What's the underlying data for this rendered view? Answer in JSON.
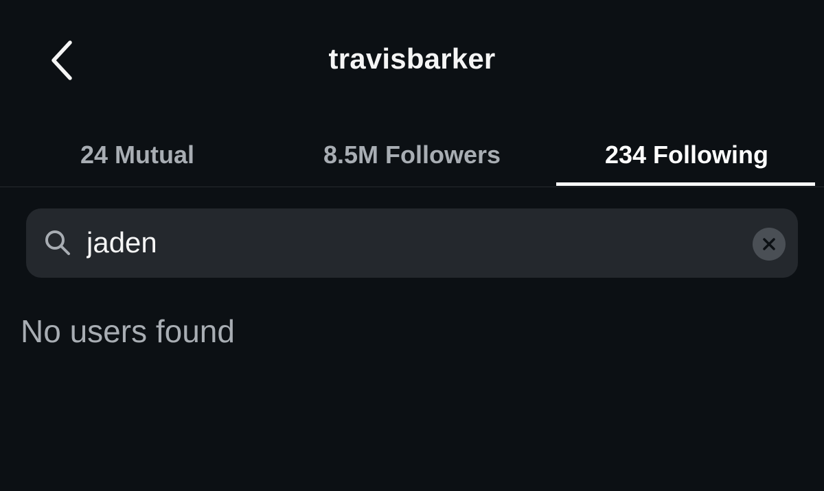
{
  "header": {
    "title": "travisbarker",
    "back_icon": "chevron-left-icon"
  },
  "tabs": [
    {
      "label": "24 Mutual",
      "active": false
    },
    {
      "label": "8.5M Followers",
      "active": false
    },
    {
      "label": "234 Following",
      "active": true
    }
  ],
  "search": {
    "icon": "search-icon",
    "value": "jaden",
    "clear_icon": "clear-icon"
  },
  "results": {
    "empty_message": "No users found"
  },
  "colors": {
    "background": "#0c1014",
    "search_bg": "#24282d",
    "muted_text": "#a8adb3",
    "active_text": "#ffffff"
  }
}
